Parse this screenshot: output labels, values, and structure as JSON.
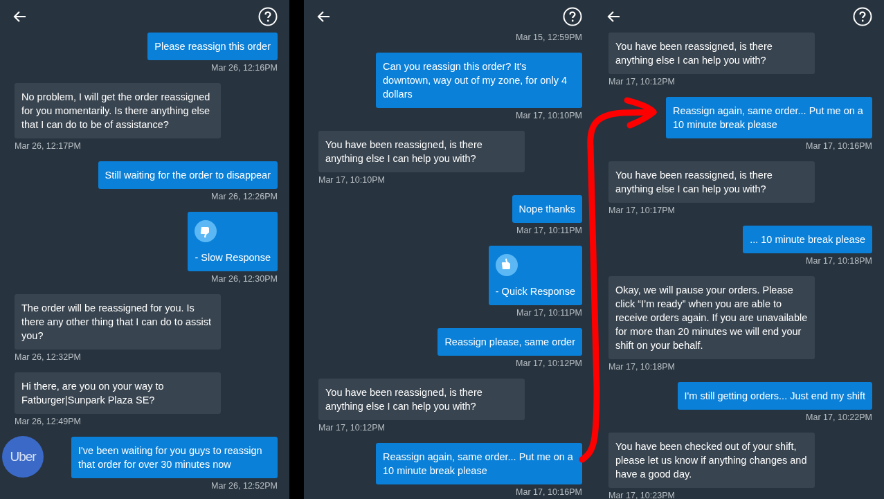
{
  "panels": [
    {
      "messages": [
        {
          "kind": "sent",
          "text": "Please reassign this order",
          "time": "Mar 26, 12:16PM"
        },
        {
          "kind": "received",
          "text": "No problem, I will get the order reassigned for you momentarily. Is there anything else that I can do to be of assistance?",
          "time": "Mar 26, 12:17PM"
        },
        {
          "kind": "sent",
          "text": "Still waiting for the order to disappear",
          "time": "Mar 26, 12:26PM"
        },
        {
          "kind": "thumbs_down",
          "text": "- Slow Response",
          "time": "Mar 26, 12:30PM"
        },
        {
          "kind": "received",
          "text": "The order will be reassigned for you. Is there any other thing that I can do to assist you?",
          "time": "Mar 26, 12:32PM"
        },
        {
          "kind": "received",
          "text": "Hi there, are you on your way to Fatburger|Sunpark Plaza SE?",
          "time": "Mar 26, 12:49PM"
        },
        {
          "kind": "sent",
          "text": "I've been waiting for you guys to reassign that order for over 30 minutes now",
          "time": "Mar 26, 12:52PM"
        }
      ],
      "floating_badge": {
        "text": "Uber"
      }
    },
    {
      "messages": [
        {
          "kind": "sent_time",
          "time": "Mar 15, 12:59PM"
        },
        {
          "kind": "sent",
          "text": "Can you reassign this order? It's downtown, way out of my zone, for only 4 dollars",
          "time": "Mar 17, 10:10PM"
        },
        {
          "kind": "received",
          "text": "You have been reassigned, is there anything else I can help you with?",
          "time": "Mar 17, 10:10PM"
        },
        {
          "kind": "sent",
          "text": "Nope thanks",
          "time": "Mar 17, 10:11PM"
        },
        {
          "kind": "thumbs_up",
          "text": "- Quick Response",
          "time": "Mar 17, 10:11PM"
        },
        {
          "kind": "sent",
          "text": "Reassign please, same order",
          "time": "Mar 17, 10:12PM"
        },
        {
          "kind": "received",
          "text": "You have been reassigned, is there anything else I can help you with?",
          "time": "Mar 17, 10:12PM"
        },
        {
          "kind": "sent",
          "text": "Reassign again, same order... Put me on a 10 minute break please",
          "time": "Mar 17, 10:16PM"
        }
      ]
    },
    {
      "messages": [
        {
          "kind": "received",
          "text": "You have been reassigned, is there anything else I can help you with?",
          "time": "Mar 17, 10:12PM"
        },
        {
          "kind": "sent",
          "text": "Reassign again, same order... Put me on a 10 minute break please",
          "time": "Mar 17, 10:16PM"
        },
        {
          "kind": "received",
          "text": "You have been reassigned, is there anything else I can help you with?",
          "time": "Mar 17, 10:17PM"
        },
        {
          "kind": "sent",
          "text": "... 10 minute break please",
          "time": "Mar 17, 10:18PM"
        },
        {
          "kind": "received",
          "text": "Okay, we will pause your orders. Please click “I’m ready” when you are able to receive orders again. If you are unavailable for more than 20 minutes we will end your shift on your behalf.",
          "time": "Mar 17, 10:18PM"
        },
        {
          "kind": "sent",
          "text": "I'm still getting orders... Just end my shift",
          "time": "Mar 17, 10:22PM"
        },
        {
          "kind": "received",
          "text": "You have been checked out of your shift, please let us know if anything changes and have a good day.",
          "time": "Mar 17, 10:23PM"
        }
      ]
    }
  ]
}
